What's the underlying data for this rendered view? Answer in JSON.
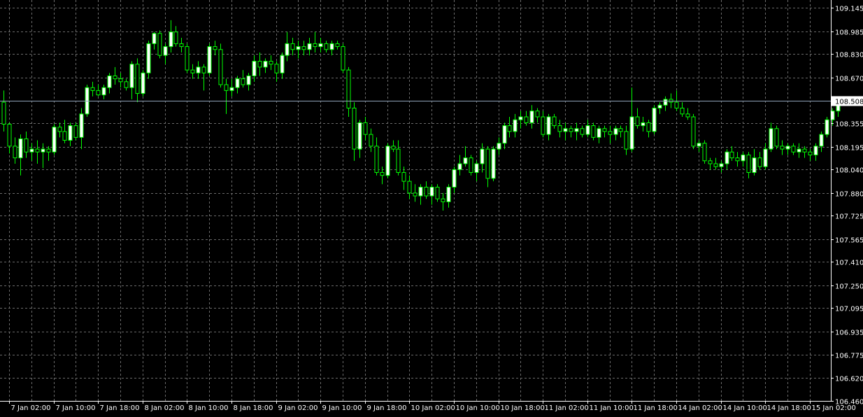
{
  "chart_data": {
    "type": "candlestick",
    "symbol": "",
    "timeframe": "H1",
    "colors": {
      "background": "#000000",
      "grid": "#6b6b6b",
      "axis": "#ffffff",
      "text": "#ffffff",
      "bull_body": "#ffffff",
      "bear_body": "#000000",
      "candle_outline": "#00ff00",
      "current_price_line": "#8fa3b8",
      "current_price_tag_bg": "#ffffff"
    },
    "grid": true,
    "ylim": [
      106.46,
      109.16
    ],
    "y_ticks": [
      "109.145",
      "108.985",
      "108.830",
      "108.670",
      "108.508",
      "108.355",
      "108.195",
      "108.040",
      "107.880",
      "107.725",
      "107.565",
      "107.410",
      "107.250",
      "107.095",
      "106.935",
      "106.775",
      "106.620",
      "106.460"
    ],
    "x_ticks": [
      "7 Jan 02:00",
      "7 Jan 10:00",
      "7 Jan 18:00",
      "8 Jan 02:00",
      "8 Jan 10:00",
      "8 Jan 18:00",
      "9 Jan 02:00",
      "9 Jan 10:00",
      "9 Jan 18:00",
      "10 Jan 02:00",
      "10 Jan 10:00",
      "10 Jan 18:00",
      "11 Jan 02:00",
      "11 Jan 10:00",
      "11 Jan 18:00",
      "14 Jan 02:00",
      "14 Jan 10:00",
      "14 Jan 18:00",
      "15 Jan 02:00"
    ],
    "x_tick_index": [
      1,
      9,
      17,
      25,
      33,
      41,
      49,
      57,
      65,
      73,
      81,
      89,
      97,
      105,
      113,
      121,
      129,
      137,
      145
    ],
    "current_price": "108.508",
    "candles": [
      [
        108.5,
        108.58,
        108.3,
        108.35
      ],
      [
        108.35,
        108.36,
        108.15,
        108.2
      ],
      [
        108.2,
        108.26,
        108.08,
        108.12
      ],
      [
        108.12,
        108.28,
        108.0,
        108.25
      ],
      [
        108.25,
        108.3,
        108.12,
        108.16
      ],
      [
        108.16,
        108.22,
        108.1,
        108.18
      ],
      [
        108.18,
        108.24,
        108.08,
        108.16
      ],
      [
        108.16,
        108.22,
        108.05,
        108.18
      ],
      [
        108.18,
        108.2,
        108.1,
        108.16
      ],
      [
        108.16,
        108.35,
        108.14,
        108.33
      ],
      [
        108.33,
        108.36,
        108.26,
        108.3
      ],
      [
        108.3,
        108.38,
        108.22,
        108.24
      ],
      [
        108.24,
        108.36,
        108.2,
        108.34
      ],
      [
        108.34,
        108.36,
        108.24,
        108.26
      ],
      [
        108.26,
        108.46,
        108.18,
        108.42
      ],
      [
        108.42,
        108.62,
        108.4,
        108.6
      ],
      [
        108.6,
        108.64,
        108.54,
        108.58
      ],
      [
        108.58,
        108.62,
        108.54,
        108.55
      ],
      [
        108.55,
        108.62,
        108.52,
        108.6
      ],
      [
        108.6,
        108.7,
        108.56,
        108.68
      ],
      [
        108.68,
        108.74,
        108.62,
        108.66
      ],
      [
        108.66,
        108.7,
        108.6,
        108.64
      ],
      [
        108.64,
        108.66,
        108.58,
        108.6
      ],
      [
        108.6,
        108.78,
        108.52,
        108.76
      ],
      [
        108.76,
        108.8,
        108.5,
        108.56
      ],
      [
        108.56,
        108.72,
        108.54,
        108.7
      ],
      [
        108.7,
        108.92,
        108.66,
        108.9
      ],
      [
        108.9,
        108.98,
        108.86,
        108.97
      ],
      [
        108.97,
        108.99,
        108.8,
        108.82
      ],
      [
        108.82,
        108.9,
        108.76,
        108.88
      ],
      [
        108.88,
        109.06,
        108.84,
        108.98
      ],
      [
        108.98,
        109.02,
        108.88,
        108.9
      ],
      [
        108.9,
        108.94,
        108.84,
        108.88
      ],
      [
        108.88,
        108.9,
        108.7,
        108.72
      ],
      [
        108.72,
        108.76,
        108.66,
        108.7
      ],
      [
        108.7,
        108.78,
        108.66,
        108.74
      ],
      [
        108.74,
        108.76,
        108.58,
        108.7
      ],
      [
        108.7,
        108.9,
        108.68,
        108.88
      ],
      [
        108.88,
        108.92,
        108.82,
        108.86
      ],
      [
        108.86,
        108.9,
        108.6,
        108.62
      ],
      [
        108.62,
        108.66,
        108.42,
        108.58
      ],
      [
        108.58,
        108.66,
        108.54,
        108.6
      ],
      [
        108.6,
        108.68,
        108.56,
        108.66
      ],
      [
        108.66,
        108.72,
        108.6,
        108.62
      ],
      [
        108.62,
        108.7,
        108.58,
        108.68
      ],
      [
        108.68,
        108.82,
        108.64,
        108.78
      ],
      [
        108.78,
        108.84,
        108.68,
        108.74
      ],
      [
        108.74,
        108.8,
        108.7,
        108.78
      ],
      [
        108.78,
        108.82,
        108.72,
        108.76
      ],
      [
        108.76,
        108.78,
        108.64,
        108.7
      ],
      [
        108.7,
        108.84,
        108.66,
        108.82
      ],
      [
        108.82,
        108.98,
        108.78,
        108.9
      ],
      [
        108.9,
        108.94,
        108.82,
        108.86
      ],
      [
        108.86,
        108.92,
        108.8,
        108.88
      ],
      [
        108.88,
        108.92,
        108.82,
        108.86
      ],
      [
        108.86,
        108.94,
        108.82,
        108.9
      ],
      [
        108.9,
        108.98,
        108.84,
        108.88
      ],
      [
        108.88,
        108.94,
        108.84,
        108.9
      ],
      [
        108.9,
        108.92,
        108.84,
        108.86
      ],
      [
        108.86,
        108.92,
        108.82,
        108.9
      ],
      [
        108.9,
        108.92,
        108.86,
        108.88
      ],
      [
        108.88,
        108.9,
        108.7,
        108.72
      ],
      [
        108.72,
        108.74,
        108.4,
        108.46
      ],
      [
        108.46,
        108.5,
        108.1,
        108.18
      ],
      [
        108.18,
        108.38,
        108.12,
        108.36
      ],
      [
        108.36,
        108.4,
        108.24,
        108.28
      ],
      [
        108.28,
        108.32,
        108.16,
        108.2
      ],
      [
        108.2,
        108.26,
        108.0,
        108.02
      ],
      [
        108.02,
        108.06,
        107.94,
        108.0
      ],
      [
        108.0,
        108.22,
        107.98,
        108.2
      ],
      [
        108.2,
        108.24,
        108.16,
        108.18
      ],
      [
        108.18,
        108.24,
        108.0,
        108.02
      ],
      [
        108.02,
        108.06,
        107.9,
        107.96
      ],
      [
        107.96,
        108.0,
        107.84,
        107.88
      ],
      [
        107.88,
        107.94,
        107.82,
        107.86
      ],
      [
        107.86,
        107.94,
        107.8,
        107.92
      ],
      [
        107.92,
        107.96,
        107.84,
        107.86
      ],
      [
        107.86,
        107.94,
        107.8,
        107.92
      ],
      [
        107.92,
        107.94,
        107.82,
        107.84
      ],
      [
        107.84,
        107.88,
        107.76,
        107.82
      ],
      [
        107.82,
        107.94,
        107.78,
        107.92
      ],
      [
        107.92,
        108.06,
        107.88,
        108.04
      ],
      [
        108.04,
        108.14,
        108.0,
        108.08
      ],
      [
        108.08,
        108.2,
        108.06,
        108.12
      ],
      [
        108.12,
        108.14,
        108.0,
        108.02
      ],
      [
        108.02,
        108.1,
        107.96,
        108.08
      ],
      [
        108.08,
        108.22,
        108.02,
        108.18
      ],
      [
        108.18,
        108.2,
        107.92,
        107.98
      ],
      [
        107.98,
        108.2,
        107.96,
        108.18
      ],
      [
        108.18,
        108.26,
        108.14,
        108.22
      ],
      [
        108.22,
        108.36,
        108.18,
        108.34
      ],
      [
        108.34,
        108.4,
        108.26,
        108.3
      ],
      [
        108.3,
        108.42,
        108.26,
        108.38
      ],
      [
        108.38,
        108.44,
        108.32,
        108.4
      ],
      [
        108.4,
        108.44,
        108.34,
        108.36
      ],
      [
        108.36,
        108.48,
        108.32,
        108.44
      ],
      [
        108.44,
        108.46,
        108.36,
        108.4
      ],
      [
        108.4,
        108.44,
        108.26,
        108.28
      ],
      [
        108.28,
        108.42,
        108.24,
        108.4
      ],
      [
        108.4,
        108.42,
        108.32,
        108.34
      ],
      [
        108.34,
        108.38,
        108.26,
        108.3
      ],
      [
        108.3,
        108.36,
        108.24,
        108.32
      ],
      [
        108.32,
        108.34,
        108.26,
        108.3
      ],
      [
        108.3,
        108.36,
        108.24,
        108.32
      ],
      [
        108.32,
        108.34,
        108.26,
        108.28
      ],
      [
        108.28,
        108.38,
        108.26,
        108.34
      ],
      [
        108.34,
        108.36,
        108.24,
        108.26
      ],
      [
        108.26,
        108.34,
        108.22,
        108.32
      ],
      [
        108.32,
        108.34,
        108.26,
        108.3
      ],
      [
        108.3,
        108.34,
        108.22,
        108.28
      ],
      [
        108.28,
        108.34,
        108.24,
        108.32
      ],
      [
        108.32,
        108.34,
        108.26,
        108.3
      ],
      [
        108.3,
        108.34,
        108.14,
        108.18
      ],
      [
        108.18,
        108.6,
        108.16,
        108.4
      ],
      [
        108.4,
        108.46,
        108.32,
        108.34
      ],
      [
        108.34,
        108.4,
        108.3,
        108.36
      ],
      [
        108.36,
        108.38,
        108.26,
        108.3
      ],
      [
        108.3,
        108.48,
        108.28,
        108.46
      ],
      [
        108.46,
        108.5,
        108.42,
        108.48
      ],
      [
        108.48,
        108.54,
        108.44,
        108.52
      ],
      [
        108.52,
        108.56,
        108.46,
        108.5
      ],
      [
        108.5,
        108.58,
        108.44,
        108.46
      ],
      [
        108.46,
        108.5,
        108.4,
        108.42
      ],
      [
        108.42,
        108.46,
        108.38,
        108.4
      ],
      [
        108.4,
        108.42,
        108.18,
        108.2
      ],
      [
        108.2,
        108.24,
        108.16,
        108.22
      ],
      [
        108.22,
        108.24,
        108.08,
        108.1
      ],
      [
        108.1,
        108.12,
        108.04,
        108.08
      ],
      [
        108.08,
        108.12,
        108.04,
        108.06
      ],
      [
        108.06,
        108.1,
        108.02,
        108.08
      ],
      [
        108.08,
        108.18,
        108.04,
        108.16
      ],
      [
        108.16,
        108.2,
        108.1,
        108.12
      ],
      [
        108.12,
        108.16,
        108.06,
        108.1
      ],
      [
        108.1,
        108.16,
        108.06,
        108.14
      ],
      [
        108.14,
        108.16,
        107.98,
        108.02
      ],
      [
        108.02,
        108.18,
        108.0,
        108.12
      ],
      [
        108.12,
        108.16,
        108.04,
        108.06
      ],
      [
        108.06,
        108.22,
        108.04,
        108.18
      ],
      [
        108.18,
        108.36,
        108.16,
        108.32
      ],
      [
        108.32,
        108.34,
        108.18,
        108.2
      ],
      [
        108.2,
        108.24,
        108.14,
        108.18
      ],
      [
        108.18,
        108.22,
        108.14,
        108.2
      ],
      [
        108.2,
        108.22,
        108.14,
        108.16
      ],
      [
        108.16,
        108.22,
        108.12,
        108.18
      ],
      [
        108.18,
        108.2,
        108.12,
        108.16
      ],
      [
        108.16,
        108.18,
        108.1,
        108.14
      ],
      [
        108.14,
        108.22,
        108.1,
        108.2
      ],
      [
        108.2,
        108.3,
        108.16,
        108.28
      ],
      [
        108.28,
        108.4,
        108.26,
        108.38
      ],
      [
        108.38,
        108.46,
        108.34,
        108.44
      ],
      [
        108.44,
        108.52,
        108.4,
        108.51
      ]
    ]
  }
}
